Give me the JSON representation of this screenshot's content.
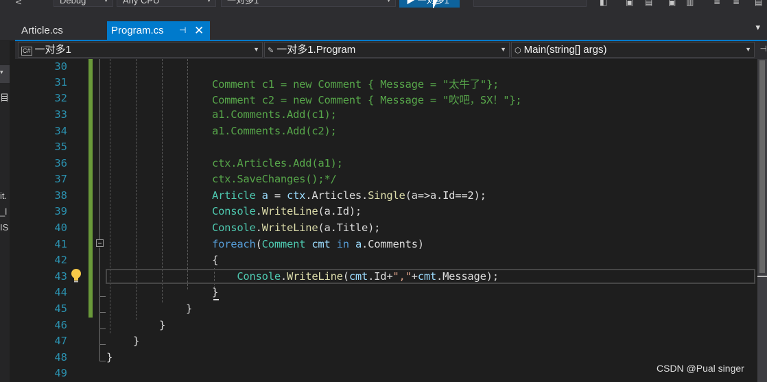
{
  "toolbar": {
    "config": "Debug",
    "platform": "Any CPU",
    "startup_project": "一对多1",
    "run_label": "一对多1"
  },
  "tabs": [
    {
      "label": "Article.cs",
      "active": false
    },
    {
      "label": "Program.cs",
      "active": true
    }
  ],
  "tab_icons": {
    "pin": "pin-icon",
    "close": "close-icon"
  },
  "navbar": {
    "project": "一对多1",
    "type": "一对多1.Program",
    "member": "Main(string[] args)",
    "project_badge": "C#"
  },
  "left_panel": {
    "items": [
      "目",
      "it.",
      "_l",
      "IS"
    ]
  },
  "editor": {
    "line_numbers": [
      "30",
      "31",
      "32",
      "33",
      "34",
      "35",
      "36",
      "37",
      "38",
      "39",
      "40",
      "41",
      "42",
      "43",
      "44",
      "45",
      "46",
      "47",
      "48",
      "49"
    ],
    "current_line": "43"
  },
  "colors": {
    "accent": "#007acc",
    "line_number": "#2b91af",
    "comment": "#57a64a",
    "keyword": "#569cd6",
    "type": "#4ec9b0",
    "string": "#d69d85",
    "method": "#dcdcaa",
    "variable": "#9cdcfe"
  },
  "watermark": "CSDN @Pual singer"
}
